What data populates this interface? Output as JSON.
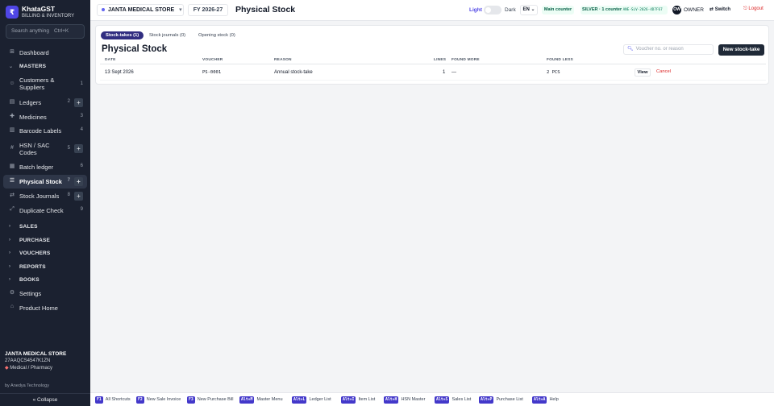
{
  "sidebar": {
    "brand_icon": "₹",
    "brand_name": "KhataGST",
    "brand_sub": "BILLING & INVENTORY",
    "search_placeholder": "Search anything",
    "search_shortcut": "Ctrl+K",
    "items": [
      {
        "label": "Dashboard",
        "icon": "⊞",
        "count": ""
      },
      {
        "label": "Customers & Suppliers",
        "icon": "☺",
        "count": "1"
      },
      {
        "label": "Ledgers",
        "icon": "▤",
        "count": "2"
      },
      {
        "label": "Medicines",
        "icon": "✚",
        "count": "3"
      },
      {
        "label": "Barcode Labels",
        "icon": "▥",
        "count": "4"
      },
      {
        "label": "HSN / SAC Codes",
        "icon": "#",
        "count": "5"
      },
      {
        "label": "Batch ledger",
        "icon": "▦",
        "count": "6"
      },
      {
        "label": "Physical Stock",
        "icon": "☰",
        "count": "7"
      },
      {
        "label": "Stock Journals",
        "icon": "⇄",
        "count": "8"
      },
      {
        "label": "Duplicate Check",
        "icon": "⤢",
        "count": "9"
      },
      {
        "label": "Settings",
        "icon": "⚙",
        "count": ""
      },
      {
        "label": "Product Home",
        "icon": "⌂",
        "count": ""
      }
    ],
    "groups": {
      "masters": "MASTERS",
      "sales": "SALES",
      "purchase": "PURCHASE",
      "vouchers": "VOUCHERS",
      "reports": "REPORTS",
      "books": "BOOKS"
    },
    "footer": {
      "store": "JANTA MEDICAL STORE",
      "gstin": "27AAQCS4547K1ZN",
      "category": "Medical / Pharmacy",
      "by": "by Anedya Technology",
      "collapse": "« Collapse"
    }
  },
  "topbar": {
    "store": "JANTA MEDICAL STORE",
    "fy": "FY 2026-27",
    "title": "Physical Stock",
    "light": "Light",
    "dark": "Dark",
    "lang": "EN",
    "counter": "Main counter",
    "plan": "SILVER · 1 counter",
    "plan_code": "ANE-SLV-2026-4D7F67",
    "avatar": "OW",
    "role": "OWNER",
    "switch": "⇄ Switch",
    "logout": "⎋ Logout"
  },
  "main": {
    "tabs": [
      "Stock-takes (1)",
      "Stock journals (0)",
      "Opening stock (0)"
    ],
    "title": "Physical Stock",
    "search_placeholder": "Voucher no. or reason",
    "new_button": "New stock-take",
    "columns": [
      "DATE",
      "VOUCHER",
      "REASON",
      "LINES",
      "FOUND MORE",
      "FOUND LESS"
    ],
    "rows": [
      {
        "date": "13 Sept 2026",
        "voucher": "PS-0001",
        "reason": "Annual stock-take",
        "lines": "1",
        "found_more": "—",
        "found_less": "2 PCS",
        "view": "View",
        "cancel": "Cancel"
      }
    ]
  },
  "shortcuts": [
    {
      "key": "F1",
      "label": "All Shortcuts"
    },
    {
      "key": "F2",
      "label": "New Sale Invoice"
    },
    {
      "key": "F3",
      "label": "New Purchase Bill"
    },
    {
      "key": "Alt+M",
      "label": "Master Menu"
    },
    {
      "key": "Alt+L",
      "label": "Ledger List"
    },
    {
      "key": "Alt+I",
      "label": "Item List"
    },
    {
      "key": "Alt+H",
      "label": "HSN Master"
    },
    {
      "key": "Alt+S",
      "label": "Sales List"
    },
    {
      "key": "Alt+P",
      "label": "Purchase List"
    },
    {
      "key": "Alt+A",
      "label": "Help"
    }
  ],
  "colors": {
    "accent": "#4f46e5",
    "sidebar_bg": "#1b2130",
    "danger": "#dc2626",
    "badge_green": "#065f46"
  }
}
